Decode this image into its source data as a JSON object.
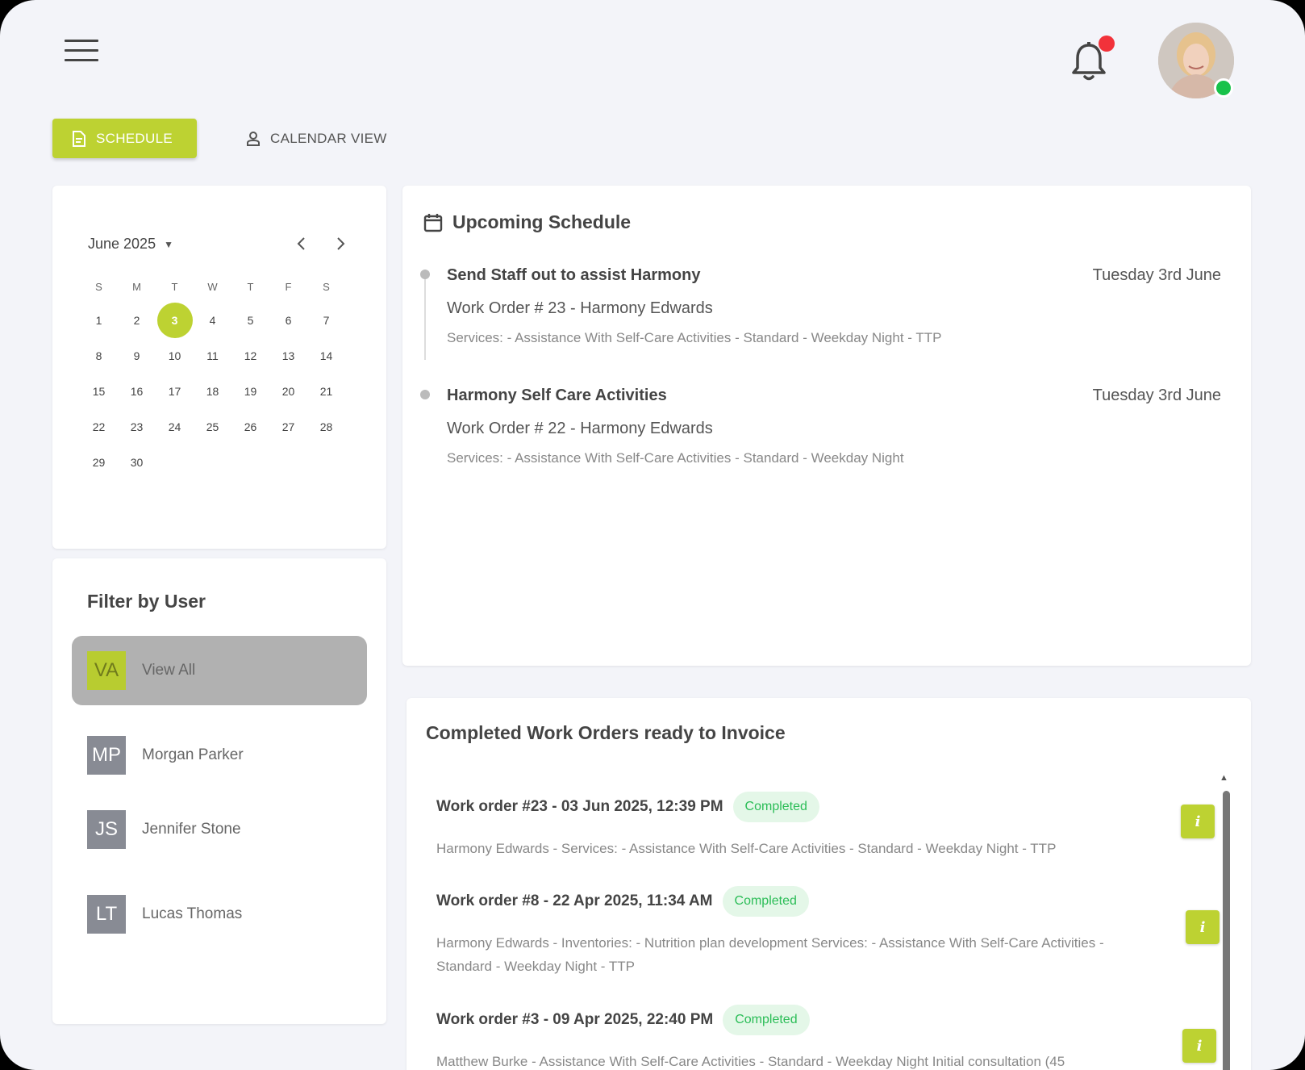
{
  "header": {
    "menu_icon": "hamburger-menu-icon",
    "notification_icon": "bell-icon",
    "notification_badge_color": "#f2323a",
    "online_status_color": "#18c24a"
  },
  "tabs": [
    {
      "label": "SCHEDULE",
      "icon": "document-icon",
      "active": true
    },
    {
      "label": "CALENDAR VIEW",
      "icon": "person-icon",
      "active": false
    }
  ],
  "calendar": {
    "month_label": "June 2025",
    "weekdays": [
      "S",
      "M",
      "T",
      "W",
      "T",
      "F",
      "S"
    ],
    "days": [
      "1",
      "2",
      "3",
      "4",
      "5",
      "6",
      "7",
      "8",
      "9",
      "10",
      "11",
      "12",
      "13",
      "14",
      "15",
      "16",
      "17",
      "18",
      "19",
      "20",
      "21",
      "22",
      "23",
      "24",
      "25",
      "26",
      "27",
      "28",
      "29",
      "30"
    ],
    "selected_day": "3",
    "accent_color": "#bdd232"
  },
  "filter": {
    "title": "Filter by User",
    "users": [
      {
        "initials": "VA",
        "name": "View All",
        "active": true
      },
      {
        "initials": "MP",
        "name": "Morgan Parker",
        "active": false
      },
      {
        "initials": "JS",
        "name": "Jennifer Stone",
        "active": false
      },
      {
        "initials": "LT",
        "name": "Lucas Thomas",
        "active": false
      }
    ]
  },
  "schedule": {
    "title": "Upcoming Schedule",
    "icon": "calendar-icon",
    "events": [
      {
        "title": "Send Staff out to assist Harmony",
        "date": "Tuesday 3rd June",
        "work_order": "Work Order # 23 - Harmony Edwards",
        "services": "Services: - Assistance With Self-Care Activities - Standard - Weekday Night - TTP"
      },
      {
        "title": "Harmony Self Care Activities",
        "date": "Tuesday 3rd June",
        "work_order": "Work Order # 22 - Harmony Edwards",
        "services": "Services: - Assistance With Self-Care Activities - Standard - Weekday Night"
      }
    ]
  },
  "invoices": {
    "title": "Completed Work Orders ready to Invoice",
    "items": [
      {
        "name": "Work order #23 - 03 Jun 2025, 12:39 PM",
        "status": "Completed",
        "description": "Harmony Edwards - Services: - Assistance With Self-Care Activities - Standard - Weekday Night - TTP"
      },
      {
        "name": "Work order #8 - 22 Apr 2025, 11:34 AM",
        "status": "Completed",
        "description": "Harmony Edwards - Inventories: - Nutrition plan development Services: - Assistance With Self-Care Activities - Standard - Weekday Night - TTP"
      },
      {
        "name": "Work order #3 - 09 Apr 2025, 22:40 PM",
        "status": "Completed",
        "description": "Matthew Burke - Assistance With Self-Care Activities - Standard - Weekday Night Initial consultation (45"
      }
    ],
    "info_label": "i"
  }
}
